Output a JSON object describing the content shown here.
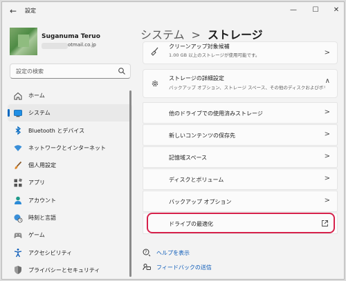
{
  "window": {
    "title": "設定"
  },
  "profile": {
    "name": "Suganuma Teruo",
    "email_visible": "otmail.co.jp"
  },
  "search": {
    "placeholder": "設定の検索"
  },
  "sidebar": {
    "items": [
      {
        "label": "ホーム",
        "icon": "home-icon"
      },
      {
        "label": "システム",
        "icon": "system-icon",
        "selected": true
      },
      {
        "label": "Bluetooth とデバイス",
        "icon": "bluetooth-icon"
      },
      {
        "label": "ネットワークとインターネット",
        "icon": "wifi-icon"
      },
      {
        "label": "個人用設定",
        "icon": "brush-icon"
      },
      {
        "label": "アプリ",
        "icon": "apps-icon"
      },
      {
        "label": "アカウント",
        "icon": "account-icon"
      },
      {
        "label": "時刻と言語",
        "icon": "globe-clock-icon"
      },
      {
        "label": "ゲーム",
        "icon": "gamepad-icon"
      },
      {
        "label": "アクセシビリティ",
        "icon": "accessibility-icon"
      },
      {
        "label": "プライバシーとセキュリティ",
        "icon": "shield-icon"
      }
    ]
  },
  "breadcrumb": {
    "parent": "システム",
    "separator": ">",
    "current": "ストレージ"
  },
  "cleanup_card": {
    "title": "クリーンアップ対象候補",
    "subtitle": "1.00 GB 以上のストレージが使用可能です。"
  },
  "advanced": {
    "title": "ストレージの詳細設定",
    "subtitle": "バックアップ オプション、ストレージ スペース、その他のディスクおよびボリューム"
  },
  "rows": [
    {
      "label": "他のドライブでの使用済みストレージ"
    },
    {
      "label": "新しいコンテンツの保存先"
    },
    {
      "label": "記憶域スペース"
    },
    {
      "label": "ディスクとボリューム"
    },
    {
      "label": "バックアップ オプション"
    },
    {
      "label": "ドライブの最適化"
    }
  ],
  "links": {
    "help": "ヘルプを表示",
    "feedback": "フィードバックの送信"
  },
  "colors": {
    "accent": "#0067c0",
    "highlight": "#d6204a",
    "link": "#0a5ab8"
  }
}
